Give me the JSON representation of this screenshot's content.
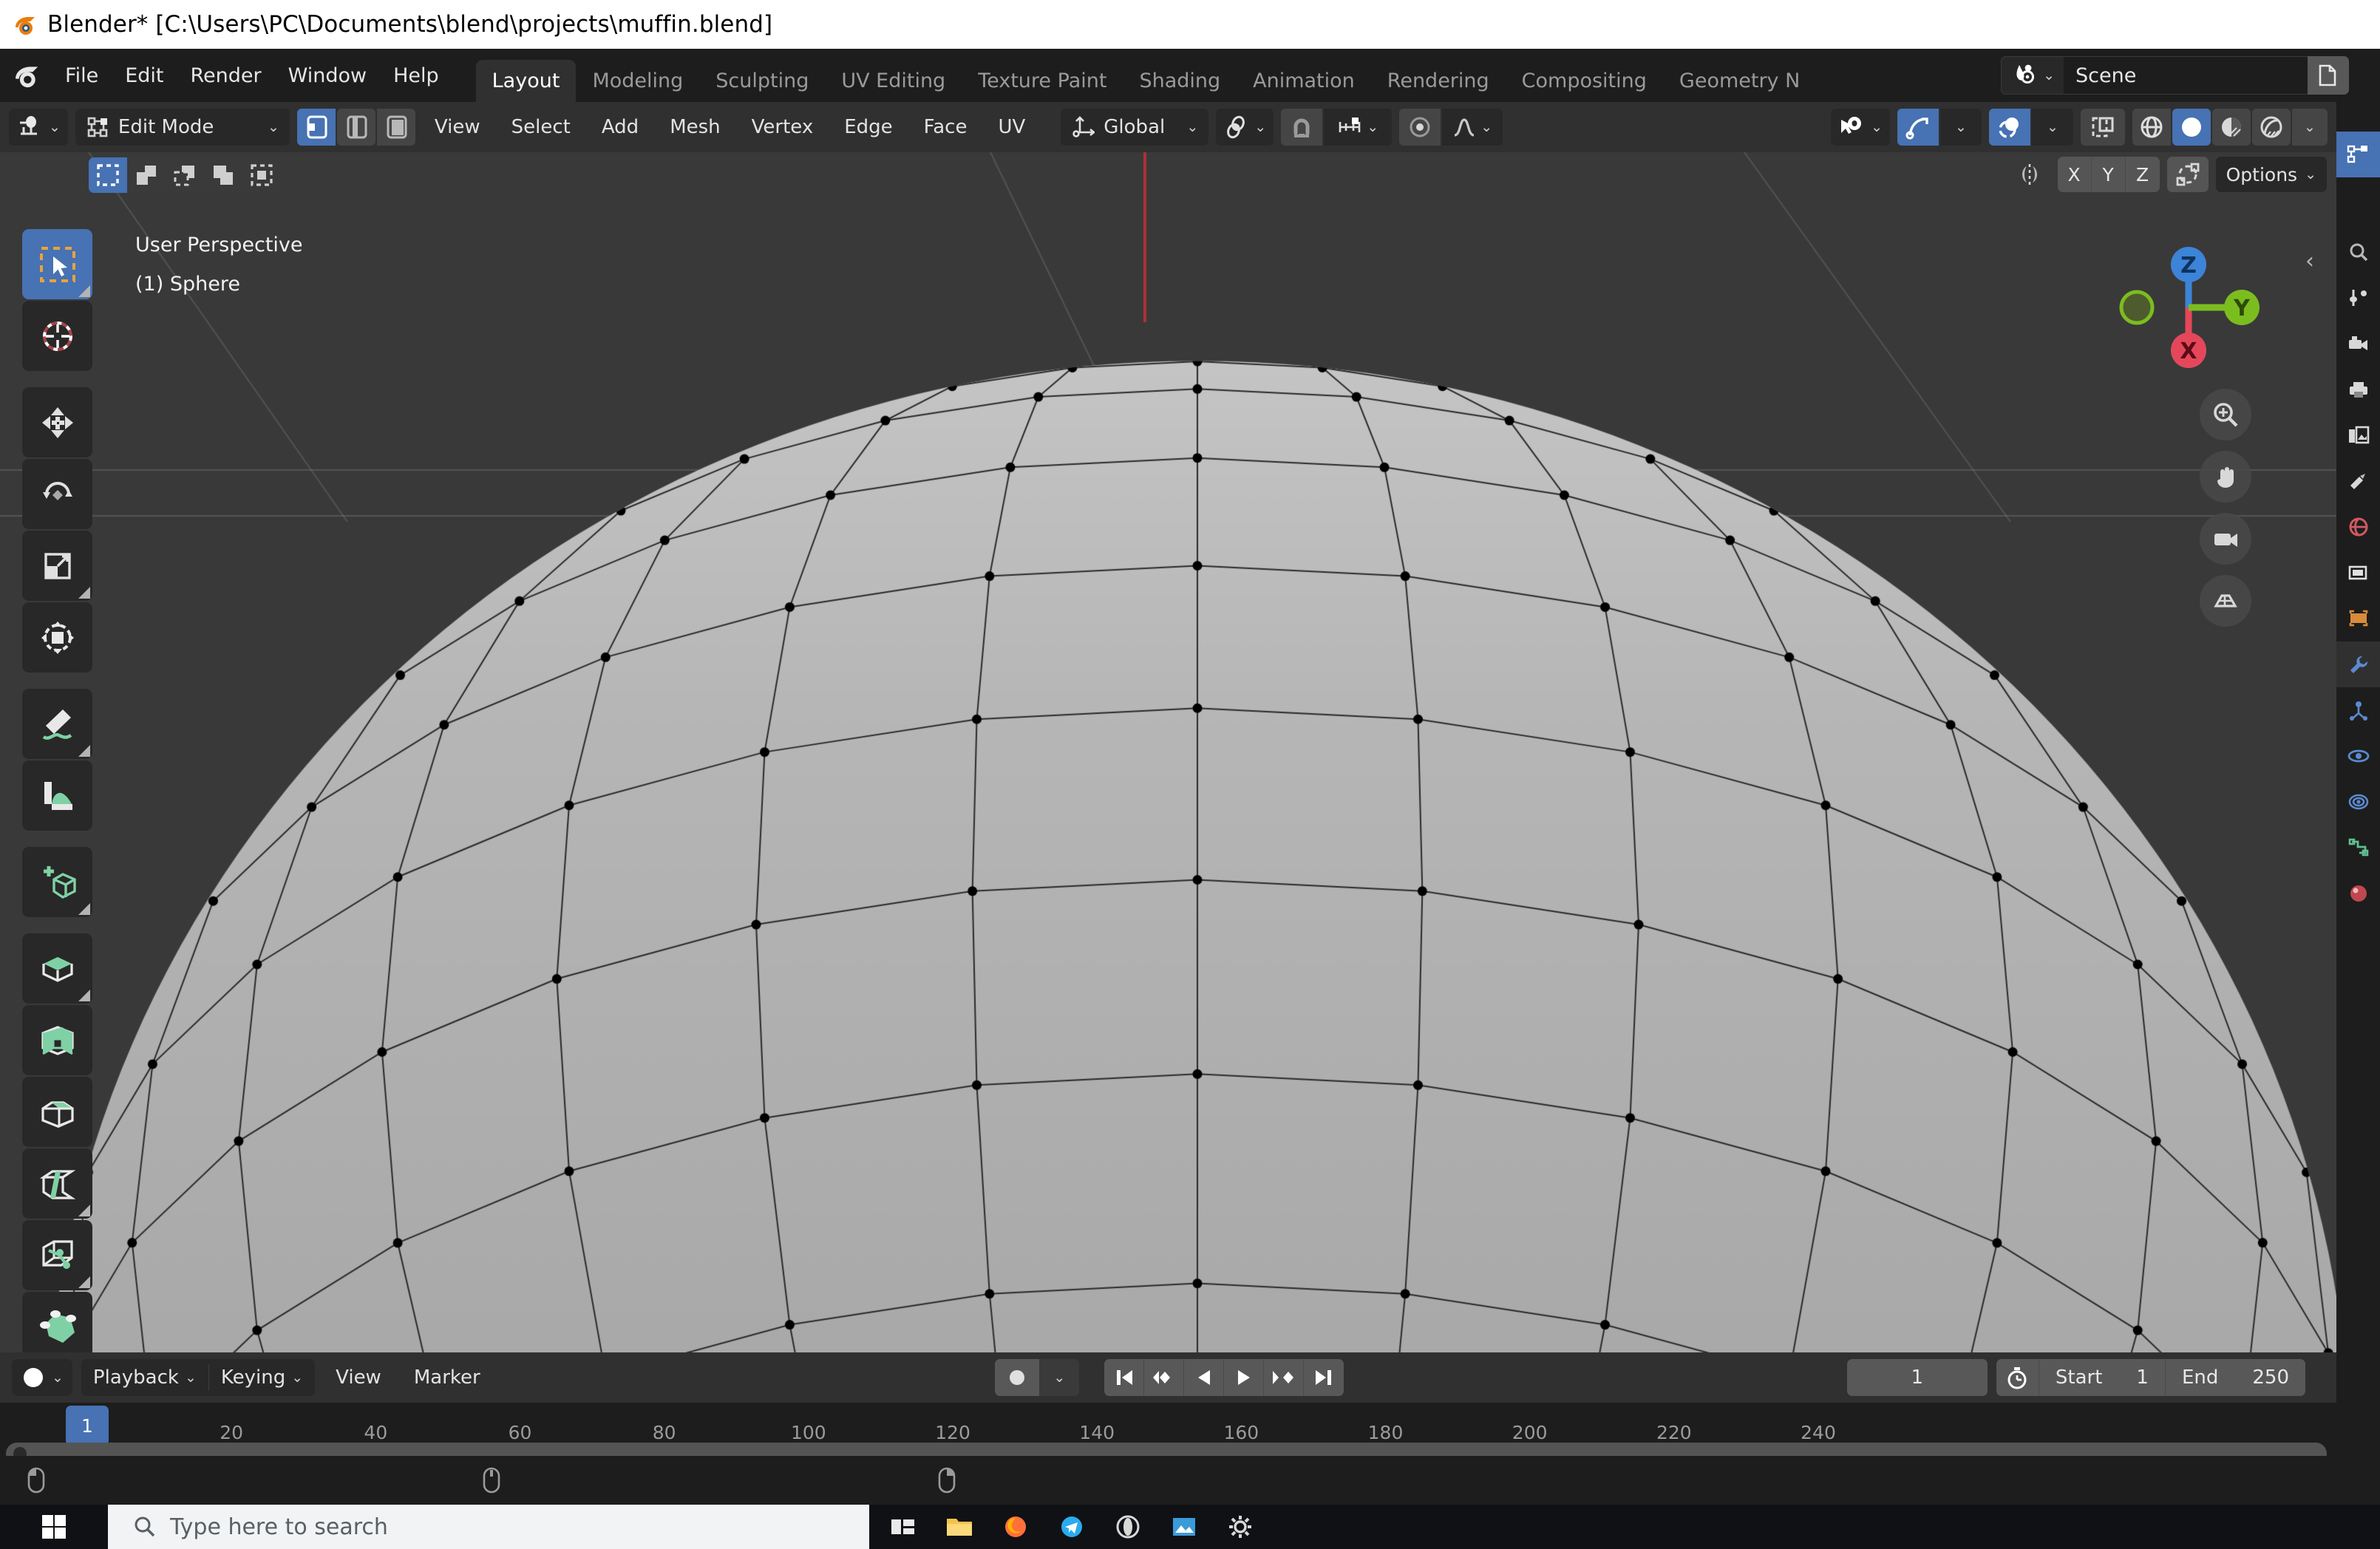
{
  "window": {
    "title": "Blender* [C:\\Users\\PC\\Documents\\blend\\projects\\muffin.blend]",
    "app_icon": "blender-logo-icon"
  },
  "topbar": {
    "menus": [
      "File",
      "Edit",
      "Render",
      "Window",
      "Help"
    ],
    "workspace_tabs": [
      {
        "label": "Layout",
        "active": true
      },
      {
        "label": "Modeling",
        "active": false
      },
      {
        "label": "Sculpting",
        "active": false
      },
      {
        "label": "UV Editing",
        "active": false
      },
      {
        "label": "Texture Paint",
        "active": false
      },
      {
        "label": "Shading",
        "active": false
      },
      {
        "label": "Animation",
        "active": false
      },
      {
        "label": "Rendering",
        "active": false
      },
      {
        "label": "Compositing",
        "active": false
      },
      {
        "label": "Geometry N",
        "active": false
      }
    ],
    "scene": {
      "browse_icon": "scene-browse-icon",
      "name": "Scene",
      "new_icon": "new-scene-icon"
    }
  },
  "viewport_header": {
    "editor_type_icon": "editor-type-3dview-icon",
    "mode": "Edit Mode",
    "mode_icon": "edit-mode-icon",
    "select_modes": [
      {
        "name": "vertex-select-mode",
        "active": true
      },
      {
        "name": "edge-select-mode",
        "active": false
      },
      {
        "name": "face-select-mode",
        "active": false
      }
    ],
    "menus": [
      "View",
      "Select",
      "Add",
      "Mesh",
      "Vertex",
      "Edge",
      "Face",
      "UV"
    ],
    "transform_orientation": {
      "icon": "orientation-icon",
      "value": "Global"
    },
    "pivot_icon": "pivot-point-icon",
    "snap_magnet_icon": "snap-magnet-icon",
    "snap_target_icon": "snap-increment-icon",
    "proportional_icon": "proportional-editing-icon",
    "falloff_icon": "proportional-falloff-icon",
    "visibility_icon": "object-visibility-icon",
    "gizmo_icon": "show-gizmo-icon",
    "overlays_icon": "show-overlays-icon",
    "xray_icon": "toggle-xray-icon",
    "shading_modes": [
      {
        "name": "wireframe-shading",
        "active": false
      },
      {
        "name": "solid-shading",
        "active": true
      },
      {
        "name": "material-preview-shading",
        "active": false
      },
      {
        "name": "rendered-shading",
        "active": false
      }
    ]
  },
  "viewport_row2": {
    "select_tool_modes": [
      {
        "name": "select-set-mode",
        "active": true
      },
      {
        "name": "select-extend-mode",
        "active": false
      },
      {
        "name": "select-subtract-mode",
        "active": false
      },
      {
        "name": "select-invert-mode",
        "active": false
      },
      {
        "name": "select-intersect-mode",
        "active": false
      }
    ],
    "mirror_icon": "mirror-icon",
    "mirror_axes": [
      "X",
      "Y",
      "Z"
    ],
    "proportional_edit_icon": "proportional-connected-icon",
    "options_label": "Options"
  },
  "viewport": {
    "perspective_label": "User Perspective",
    "object_label": "(1) Sphere",
    "background_color": "#393939",
    "mesh_fill_color": "#b3b3b3",
    "wire_color": "#2a2a2a",
    "vertex_color": "#000000"
  },
  "toolbar": {
    "tools": [
      {
        "name": "tweak-select-box-tool",
        "icon": "select-box-icon",
        "active": true,
        "has_submenu": true
      },
      {
        "name": "cursor-tool",
        "icon": "3d-cursor-icon",
        "active": false,
        "has_submenu": false
      },
      {
        "name": "move-tool",
        "icon": "move-arrows-icon",
        "active": false,
        "has_submenu": false
      },
      {
        "name": "rotate-tool",
        "icon": "rotate-icon",
        "active": false,
        "has_submenu": false
      },
      {
        "name": "scale-tool",
        "icon": "scale-icon",
        "active": false,
        "has_submenu": true
      },
      {
        "name": "transform-tool",
        "icon": "transform-icon",
        "active": false,
        "has_submenu": false
      },
      {
        "name": "annotate-tool",
        "icon": "annotate-pencil-icon",
        "active": false,
        "has_submenu": true
      },
      {
        "name": "measure-tool",
        "icon": "measure-ruler-icon",
        "active": false,
        "has_submenu": false
      },
      {
        "name": "add-cube-tool",
        "icon": "add-cube-icon",
        "active": false,
        "has_submenu": true
      },
      {
        "name": "extrude-region-tool",
        "icon": "extrude-region-icon",
        "active": false,
        "has_submenu": true
      },
      {
        "name": "inset-faces-tool",
        "icon": "inset-faces-icon",
        "active": false,
        "has_submenu": false
      },
      {
        "name": "bevel-tool",
        "icon": "bevel-icon",
        "active": false,
        "has_submenu": false
      },
      {
        "name": "loop-cut-tool",
        "icon": "loop-cut-icon",
        "active": false,
        "has_submenu": true
      },
      {
        "name": "knife-tool",
        "icon": "knife-icon",
        "active": false,
        "has_submenu": true
      },
      {
        "name": "poly-build-tool",
        "icon": "poly-build-icon",
        "active": false,
        "has_submenu": false
      }
    ]
  },
  "nav_gizmo": {
    "axes": [
      {
        "label": "Z",
        "color": "#3b84d8"
      },
      {
        "label": "Y",
        "color": "#7bbd1f"
      },
      {
        "label": "X",
        "color": "#e4475a"
      }
    ],
    "buttons": [
      {
        "name": "zoom-view-icon"
      },
      {
        "name": "pan-view-icon"
      },
      {
        "name": "camera-view-icon"
      },
      {
        "name": "toggle-perspective-icon"
      }
    ]
  },
  "timeline": {
    "editor_icon": "timeline-editor-icon",
    "menus": [
      "Playback",
      "Keying",
      "View",
      "Marker"
    ],
    "auto_keying_icon": "record-auto-keying-icon",
    "transport": [
      {
        "name": "jump-to-start-button",
        "icon": "skip-start-icon"
      },
      {
        "name": "jump-to-prev-keyframe-button",
        "icon": "prev-keyframe-icon"
      },
      {
        "name": "play-reverse-button",
        "icon": "play-reverse-icon"
      },
      {
        "name": "play-button",
        "icon": "play-icon"
      },
      {
        "name": "jump-to-next-keyframe-button",
        "icon": "next-keyframe-icon"
      },
      {
        "name": "jump-to-end-button",
        "icon": "skip-end-icon"
      }
    ],
    "current_frame": "1",
    "use_preview_range_icon": "stopwatch-icon",
    "start_label": "Start",
    "start_value": "1",
    "end_label": "End",
    "end_value": "250",
    "ruler_ticks": [
      "20",
      "40",
      "60",
      "80",
      "100",
      "120",
      "140",
      "160",
      "180",
      "200",
      "220",
      "240"
    ],
    "playhead_frame": "1"
  },
  "properties_tabs": [
    {
      "name": "tool-tab",
      "icon": "tool-icon",
      "active": false
    },
    {
      "name": "render-tab",
      "icon": "render-camera-icon",
      "active": false
    },
    {
      "name": "output-tab",
      "icon": "output-printer-icon",
      "active": false
    },
    {
      "name": "view-layer-tab",
      "icon": "view-layer-images-icon",
      "active": false
    },
    {
      "name": "scene-tab",
      "icon": "scene-cone-icon",
      "active": false
    },
    {
      "name": "world-tab",
      "icon": "world-globe-icon",
      "active": false
    },
    {
      "name": "collection-tab",
      "icon": "collection-box-icon",
      "active": false
    },
    {
      "name": "object-tab",
      "icon": "object-square-icon",
      "active": false
    },
    {
      "name": "modifier-tab",
      "icon": "modifier-wrench-icon",
      "active": true
    },
    {
      "name": "particles-tab",
      "icon": "particles-icon",
      "active": false
    },
    {
      "name": "physics-tab",
      "icon": "physics-orbit-icon",
      "active": false
    },
    {
      "name": "constraints-tab",
      "icon": "constraints-icon",
      "active": false
    },
    {
      "name": "data-tab",
      "icon": "object-data-green-icon",
      "active": false
    },
    {
      "name": "material-tab",
      "icon": "material-sphere-icon",
      "active": false
    }
  ],
  "statusbar": {
    "items": [
      {
        "name": "mouse-select-hint",
        "icon": "mouse-left-icon"
      },
      {
        "name": "mouse-context-hint",
        "icon": "mouse-middle-icon"
      },
      {
        "name": "mouse-right-hint",
        "icon": "mouse-right-icon"
      }
    ]
  },
  "taskbar": {
    "start_icon": "windows-start-icon",
    "search_placeholder": "Type here to search",
    "search_icon": "search-icon",
    "apps": [
      {
        "name": "task-view-icon"
      },
      {
        "name": "file-explorer-icon"
      },
      {
        "name": "firefox-icon"
      },
      {
        "name": "telegram-icon"
      },
      {
        "name": "opera-icon"
      },
      {
        "name": "photos-icon"
      },
      {
        "name": "settings-gear-icon"
      }
    ]
  }
}
